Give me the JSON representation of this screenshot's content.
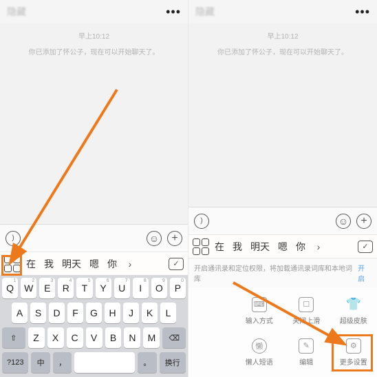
{
  "header": {
    "title": "隐藏",
    "more_icon": "more-horizontal-icon"
  },
  "chat": {
    "time": "早上10:12",
    "system_message": "你已添加了怀公子，现在可以开始聊天了。"
  },
  "input_bar": {
    "voice_icon": "sound-icon",
    "emoji_icon": "smile-icon",
    "plus_icon": "plus-circle-icon"
  },
  "candidate_row": {
    "grid_icon": "grid-icon",
    "candidates": [
      "在",
      "我",
      "明天",
      "嗯",
      "你"
    ],
    "chevron_icon": "chevron-icon",
    "check_icon": "check-list-icon"
  },
  "keyboard": {
    "row1": [
      "Q",
      "W",
      "E",
      "R",
      "T",
      "Y",
      "U",
      "I",
      "O",
      "P"
    ],
    "row2": [
      "A",
      "S",
      "D",
      "F",
      "G",
      "H",
      "J",
      "K",
      "L"
    ],
    "row3_shift": "⇧",
    "row3": [
      "Z",
      "X",
      "C",
      "V",
      "B",
      "N",
      "M"
    ],
    "row3_backspace": "⌫",
    "row4": {
      "num": "?123",
      "lang": "中",
      "comma": "，",
      "space": "",
      "period": "。",
      "enter": "换行"
    }
  },
  "settings_hint": {
    "text": "开启通讯录和定位权限，将加载通讯录词库和本地词库",
    "action": "开启"
  },
  "settings_grid": [
    {
      "icon": "keyboard-icon",
      "label": "输入方式"
    },
    {
      "icon": "swipe-icon",
      "label": "关闭上滑"
    },
    {
      "icon": "tshirt-icon",
      "label": "超级皮肤"
    },
    {
      "icon": "quick-phrase-icon",
      "label": "懒人短语"
    },
    {
      "icon": "edit-icon",
      "label": "编辑"
    },
    {
      "icon": "gear-icon",
      "label": "更多设置"
    }
  ],
  "annotations": {
    "highlight_left": "grid-menu-highlight",
    "highlight_right": "more-settings-highlight",
    "arrow_color": "#ec7a1c"
  }
}
